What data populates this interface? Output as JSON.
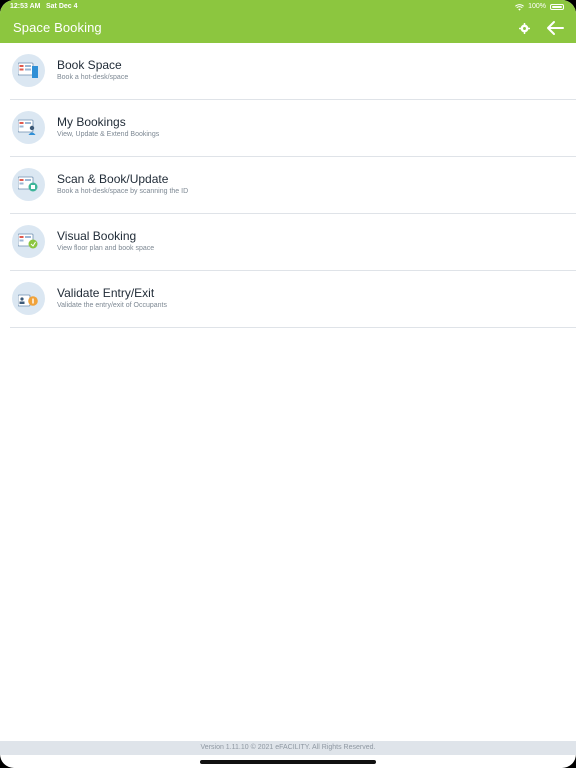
{
  "status_bar": {
    "time": "12:53 AM",
    "date": "Sat Dec 4",
    "battery": "100%",
    "icons": [
      "wifi-icon",
      "battery-icon"
    ]
  },
  "header": {
    "title": "Space Booking",
    "icons": [
      "gear-icon",
      "back-arrow-icon"
    ],
    "color": "#8cc63f"
  },
  "menu": [
    {
      "label": "Book Space",
      "sub": "Book a hot-desk/space",
      "icon": "book-space-icon"
    },
    {
      "label": "My Bookings",
      "sub": "View, Update & Extend Bookings",
      "icon": "my-bookings-icon"
    },
    {
      "label": "Scan & Book/Update",
      "sub": "Book a hot-desk/space by scanning the ID",
      "icon": "scan-book-icon"
    },
    {
      "label": "Visual Booking",
      "sub": "View floor plan and book space",
      "icon": "visual-booking-icon"
    },
    {
      "label": "Validate Entry/Exit",
      "sub": "Validate the entry/exit of Occupants",
      "icon": "validate-entry-icon"
    }
  ],
  "footer": {
    "text": "Version 1.11.10 © 2021 eFACILITY. All Rights Reserved."
  }
}
